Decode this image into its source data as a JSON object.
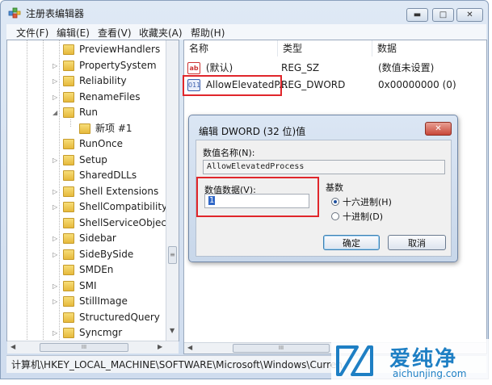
{
  "window": {
    "title": "注册表编辑器",
    "min_glyph": "▬",
    "max_glyph": "□",
    "close_glyph": "✕"
  },
  "menu": [
    "文件(F)",
    "编辑(E)",
    "查看(V)",
    "收藏夹(A)",
    "帮助(H)"
  ],
  "tree": {
    "items": [
      {
        "label": "PreviewHandlers",
        "indent": 0,
        "expander": ""
      },
      {
        "label": "PropertySystem",
        "indent": 0,
        "expander": "▷"
      },
      {
        "label": "Reliability",
        "indent": 0,
        "expander": "▷"
      },
      {
        "label": "RenameFiles",
        "indent": 0,
        "expander": "▷"
      },
      {
        "label": "Run",
        "indent": 0,
        "expander": "◢"
      },
      {
        "label": "新项 #1",
        "indent": 1,
        "expander": ""
      },
      {
        "label": "RunOnce",
        "indent": 0,
        "expander": ""
      },
      {
        "label": "Setup",
        "indent": 0,
        "expander": "▷"
      },
      {
        "label": "SharedDLLs",
        "indent": 0,
        "expander": ""
      },
      {
        "label": "Shell Extensions",
        "indent": 0,
        "expander": "▷"
      },
      {
        "label": "ShellCompatibility",
        "indent": 0,
        "expander": "▷"
      },
      {
        "label": "ShellServiceObjectD",
        "indent": 0,
        "expander": ""
      },
      {
        "label": "Sidebar",
        "indent": 0,
        "expander": "▷"
      },
      {
        "label": "SideBySide",
        "indent": 0,
        "expander": "▷"
      },
      {
        "label": "SMDEn",
        "indent": 0,
        "expander": ""
      },
      {
        "label": "SMI",
        "indent": 0,
        "expander": "▷"
      },
      {
        "label": "StillImage",
        "indent": 0,
        "expander": "▷"
      },
      {
        "label": "StructuredQuery",
        "indent": 0,
        "expander": ""
      },
      {
        "label": "Syncmgr",
        "indent": 0,
        "expander": "▷"
      }
    ],
    "hscroll_glyph": "III",
    "vscroll_glyph": "≡"
  },
  "list": {
    "headers": [
      "名称",
      "类型",
      "数据"
    ],
    "rows": [
      {
        "icon": "ab",
        "name": "(默认)",
        "type": "REG_SZ",
        "data": "(数值未设置)"
      },
      {
        "icon": "011",
        "name": "AllowElevatedP...",
        "type": "REG_DWORD",
        "data": "0x00000000 (0)"
      }
    ],
    "hscroll_glyph": "III"
  },
  "statusbar": "计算机\\HKEY_LOCAL_MACHINE\\SOFTWARE\\Microsoft\\Windows\\Curren",
  "dialog": {
    "title": "编辑 DWORD (32 位)值",
    "close_glyph": "✕",
    "name_label": "数值名称(N):",
    "name_value": "AllowElevatedProcess",
    "data_label": "数值数据(V):",
    "data_value": "1",
    "base_label": "基数",
    "radio_hex": "十六进制(H)",
    "radio_dec": "十进制(D)",
    "ok_label": "确定",
    "cancel_label": "取消"
  },
  "watermark": {
    "name": "爱纯净",
    "url": "aichunjing.com"
  },
  "colors": {
    "highlight": "#e0262b",
    "brand": "#1e7fc4"
  }
}
